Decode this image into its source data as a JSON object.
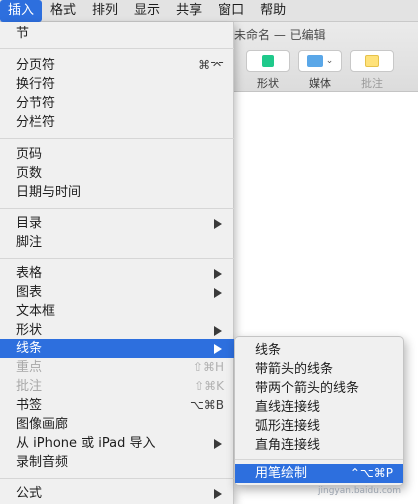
{
  "menubar": {
    "items": [
      "插入",
      "格式",
      "排列",
      "显示",
      "共享",
      "窗口",
      "帮助"
    ],
    "active": "插入"
  },
  "window": {
    "title": "未命名 — 已编辑",
    "toolbar": {
      "shape_label": "形状",
      "media_label": "媒体",
      "comment_label": "批注"
    }
  },
  "menu": {
    "items": [
      {
        "label": "节"
      },
      {
        "label": "分页符",
        "shortcut": "⌘⌤"
      },
      {
        "label": "换行符"
      },
      {
        "label": "分节符"
      },
      {
        "label": "分栏符"
      },
      {
        "label": "页码"
      },
      {
        "label": "页数"
      },
      {
        "label": "日期与时间"
      },
      {
        "label": "目录",
        "submenu": true
      },
      {
        "label": "脚注"
      },
      {
        "label": "表格",
        "submenu": true
      },
      {
        "label": "图表",
        "submenu": true
      },
      {
        "label": "文本框"
      },
      {
        "label": "形状",
        "submenu": true
      },
      {
        "label": "线条",
        "submenu": true,
        "highlighted": true
      },
      {
        "label": "重点",
        "shortcut": "⇧⌘H",
        "disabled": true
      },
      {
        "label": "批注",
        "shortcut": "⇧⌘K",
        "disabled": true
      },
      {
        "label": "书签",
        "shortcut": "⌥⌘B"
      },
      {
        "label": "图像画廊"
      },
      {
        "label": "从 iPhone 或 iPad 导入",
        "submenu": true
      },
      {
        "label": "录制音频"
      },
      {
        "label": "公式",
        "submenu": true
      }
    ]
  },
  "submenu": {
    "items": [
      {
        "label": "线条"
      },
      {
        "label": "带箭头的线条"
      },
      {
        "label": "带两个箭头的线条"
      },
      {
        "label": "直线连接线"
      },
      {
        "label": "弧形连接线"
      },
      {
        "label": "直角连接线"
      },
      {
        "label": "用笔绘制",
        "shortcut": "⌃⌥⌘P",
        "highlighted": true
      }
    ]
  },
  "watermark": "jingyan.baidu.com"
}
